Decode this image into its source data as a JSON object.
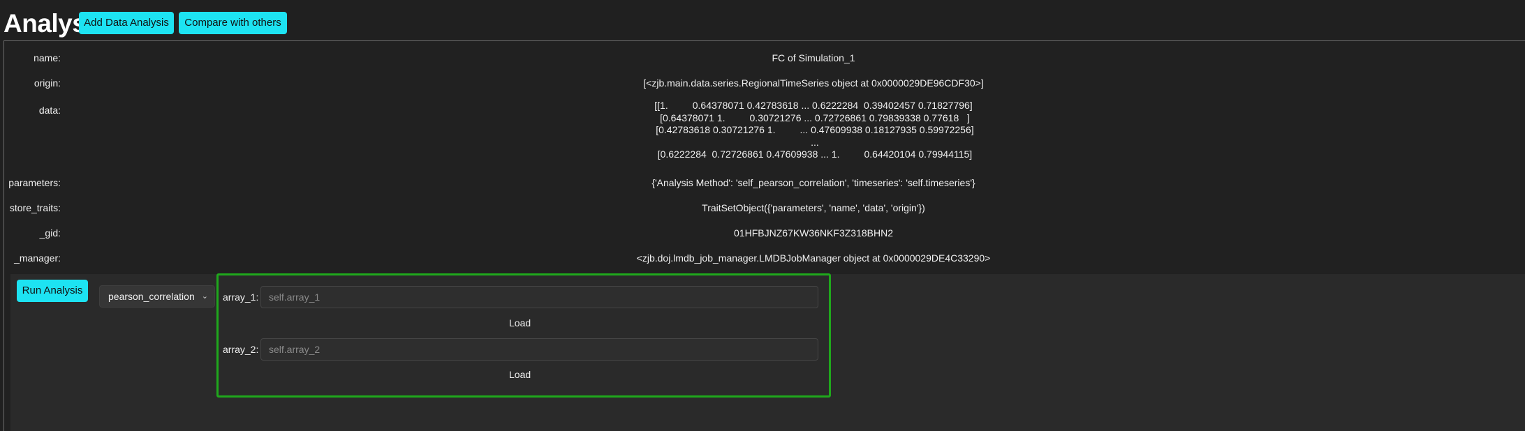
{
  "header": {
    "title": "Analysis",
    "add_button": "Add Data Analysis",
    "compare_button": "Compare with others"
  },
  "properties": [
    {
      "label": "name:",
      "value": "FC of Simulation_1"
    },
    {
      "label": "origin:",
      "value": "[<zjb.main.data.series.RegionalTimeSeries object at 0x0000029DE96CDF30>]"
    },
    {
      "label": "data:",
      "value": "[[1.         0.64378071 0.42783618 ... 0.6222284  0.39402457 0.71827796]\n [0.64378071 1.         0.30721276 ... 0.72726861 0.79839338 0.77618   ]\n [0.42783618 0.30721276 1.         ... 0.47609938 0.18127935 0.59972256]\n ...\n [0.6222284  0.72726861 0.47609938 ... 1.         0.64420104 0.79944115]"
    },
    {
      "label": "parameters:",
      "value": "{'Analysis Method': 'self_pearson_correlation', 'timeseries': 'self.timeseries'}"
    },
    {
      "label": "store_traits:",
      "value": "TraitSetObject({'parameters', 'name', 'data', 'origin'})"
    },
    {
      "label": "_gid:",
      "value": "01HFBJNZ67KW36NKF3Z318BHN2"
    },
    {
      "label": "_manager:",
      "value": "<zjb.doj.lmdb_job_manager.LMDBJobManager object at 0x0000029DE4C33290>"
    }
  ],
  "analysis": {
    "run_button": "Run Analysis",
    "method_select": "pearson_correlation",
    "args": [
      {
        "label": "array_1:",
        "placeholder": "self.array_1",
        "load": "Load"
      },
      {
        "label": "array_2:",
        "placeholder": "self.array_2",
        "load": "Load"
      }
    ]
  },
  "colors": {
    "accent": "#1de3f2",
    "highlight_border": "#1fa81c",
    "background": "#202020"
  }
}
